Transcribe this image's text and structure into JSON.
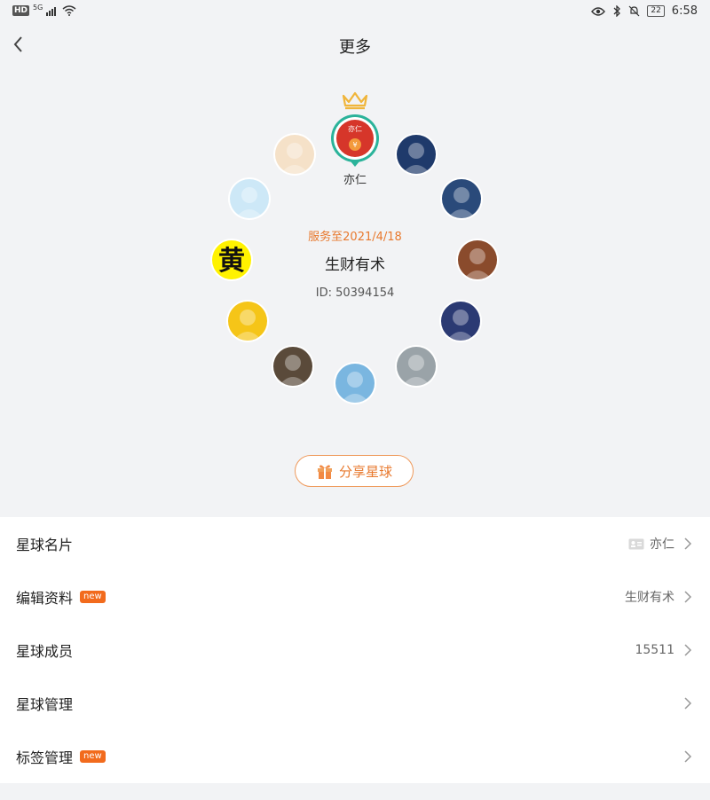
{
  "status_bar": {
    "left_badge": "HD",
    "network": "5G",
    "time": "6:58",
    "battery": "22"
  },
  "header": {
    "title": "更多"
  },
  "owner": {
    "name": "亦仁",
    "avatar_text": "亦仁"
  },
  "group": {
    "expire": "服务至2021/4/18",
    "name": "生财有术",
    "id": "ID: 50394154"
  },
  "members": [
    {
      "icon": "avatar-bald-glasses",
      "bg": "#f5e1c8",
      "glyph": ""
    },
    {
      "icon": "avatar-boy-cartoon",
      "bg": "#1f3a6b",
      "glyph": ""
    },
    {
      "icon": "avatar-man-blue",
      "bg": "#cde8f7",
      "glyph": ""
    },
    {
      "icon": "avatar-man-photo",
      "bg": "#2a4a7a",
      "glyph": ""
    },
    {
      "icon": "avatar-huang-character",
      "bg": "#fff200",
      "glyph": "黄"
    },
    {
      "icon": "avatar-food",
      "bg": "#8a4b2c",
      "glyph": ""
    },
    {
      "icon": "avatar-cartoon-character",
      "bg": "#f5c518",
      "glyph": ""
    },
    {
      "icon": "avatar-castle-night",
      "bg": "#2b3a73",
      "glyph": ""
    },
    {
      "icon": "avatar-boy-photo",
      "bg": "#5a4a3a",
      "glyph": ""
    },
    {
      "icon": "avatar-girl-glasses",
      "bg": "#9aa3a8",
      "glyph": ""
    },
    {
      "icon": "avatar-giraffe",
      "bg": "#7ab6e0",
      "glyph": ""
    }
  ],
  "share_button": {
    "label": "分享星球"
  },
  "menu": [
    {
      "label": "星球名片",
      "value": "亦仁",
      "badge": ""
    },
    {
      "label": "编辑资料",
      "value": "生财有术",
      "badge": "new"
    },
    {
      "label": "星球成员",
      "value": "15511",
      "badge": ""
    },
    {
      "label": "星球管理",
      "value": "",
      "badge": ""
    },
    {
      "label": "标签管理",
      "value": "",
      "badge": "new"
    }
  ],
  "colors": {
    "accent": "#e8792e",
    "badge": "#f26b1d",
    "owner_ring": "#2bb39a"
  }
}
